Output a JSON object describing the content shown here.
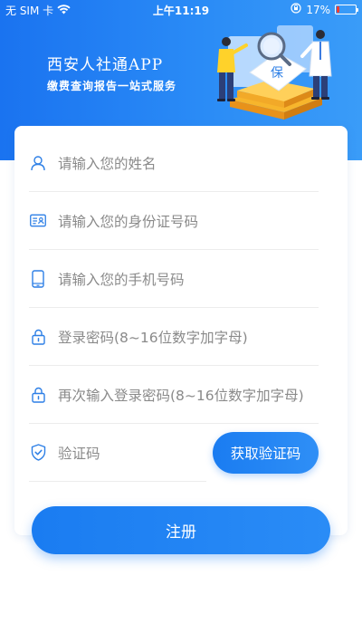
{
  "status_bar": {
    "carrier": "无 SIM 卡",
    "time": "上午11:19",
    "battery_percent": "17%",
    "battery_level": 0.17
  },
  "header": {
    "title": "西安人社通APP",
    "subtitle": "缴费查询报告一站式服务",
    "illustration_text": "保"
  },
  "form": {
    "name_placeholder": "请输入您的姓名",
    "id_placeholder": "请输入您的身份证号码",
    "phone_placeholder": "请输入您的手机号码",
    "password_placeholder": "登录密码(8~16位数字加字母)",
    "confirm_password_placeholder": "再次输入登录密码(8~16位数字加字母)",
    "code_placeholder": "验证码",
    "get_code_label": "获取验证码",
    "register_label": "注册"
  },
  "colors": {
    "primary": "#1a7cf1",
    "icon": "#2d7fe6",
    "placeholder": "#8a8a8a"
  }
}
